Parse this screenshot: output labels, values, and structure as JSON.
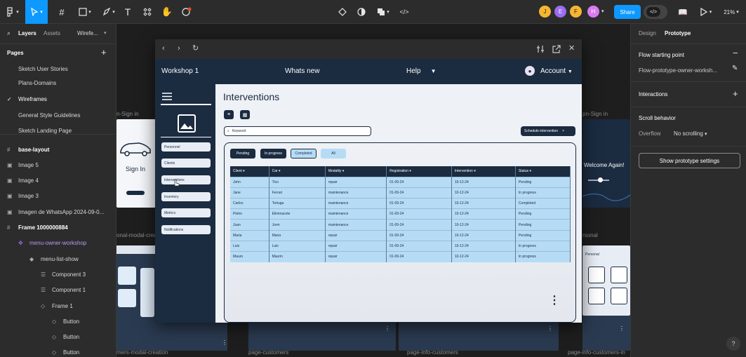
{
  "toolbar": {
    "zoom": "21%",
    "share": "Share",
    "avatars": [
      {
        "letter": "J",
        "color": "#f5b731"
      },
      {
        "letter": "E",
        "color": "#9a6cf0"
      },
      {
        "letter": "F",
        "color": "#f5b731"
      },
      {
        "letter": "H",
        "color": "#d97af0"
      }
    ]
  },
  "left_panel": {
    "tabs": [
      "Layers",
      "Assets"
    ],
    "file": "Wirefe...",
    "pages_title": "Pages",
    "pages": [
      "Sketch User Stories",
      "Plans-Domains",
      "Wireframes",
      "General Style Guidelines",
      "Sketch Landing Page"
    ],
    "current_page": "Wireframes",
    "layers": [
      {
        "name": "base-layout",
        "indent": 0,
        "bold": true
      },
      {
        "name": "Image 5",
        "indent": 0
      },
      {
        "name": "Image 4",
        "indent": 0
      },
      {
        "name": "Image 3",
        "indent": 0
      },
      {
        "name": "Imagen de WhatsApp 2024-09-0...",
        "indent": 0
      },
      {
        "name": "Frame 1000000884",
        "indent": 0,
        "bold": true
      },
      {
        "name": "menu-owner-workshop",
        "indent": 1,
        "purple": true
      },
      {
        "name": "menu-list-show",
        "indent": 2
      },
      {
        "name": "Component 3",
        "indent": 3
      },
      {
        "name": "Component 1",
        "indent": 3
      },
      {
        "name": "Frame 1",
        "indent": 3
      },
      {
        "name": "Button",
        "indent": 4
      },
      {
        "name": "Button",
        "indent": 4
      },
      {
        "name": "Button",
        "indent": 4
      }
    ]
  },
  "right_panel": {
    "tabs": [
      "Design",
      "Prototype"
    ],
    "flow_title": "Flow starting point",
    "flow_name": "Flow-prototype-owner-worksh...",
    "interactions": "Interactions",
    "scroll": "Scroll behavior",
    "overflow_label": "Overflow",
    "overflow_value": "No scrolling",
    "settings_button": "Show prototype settings",
    "help": "?"
  },
  "canvas": {
    "labels": [
      "n-Sign in",
      "onal-modal-crea",
      "pn-Sign in",
      "rsonal",
      "mers-modal-creation",
      "page-customers",
      "page-info-customers",
      "page-info-customers-in"
    ],
    "sign_in": "Sign In",
    "welcome": "Welcome Again!",
    "personal": "Personal"
  },
  "app": {
    "brand": "Workshop 1",
    "whats_new": "Whats new",
    "help": "Help",
    "account": "Account",
    "title": "Interventions",
    "search_placeholder": "Keyword",
    "schedule": "Schedule intervention",
    "side_items": [
      "Personnel",
      "Clients",
      "Interventions",
      "Inventory",
      "Metrics",
      "Notifications"
    ],
    "filters": [
      "Pending",
      "In progress",
      "Completed",
      "All"
    ],
    "columns": [
      "Client",
      "Car",
      "Modality",
      "Registration",
      "Intervention",
      "Status"
    ],
    "rows": [
      [
        "John",
        "Tico",
        "repair",
        "01-09-24",
        "10-12-24",
        "Pending"
      ],
      [
        "Jane",
        "Ferrari",
        "maintenance",
        "01-09-24",
        "10-12-24",
        "In progress"
      ],
      [
        "Carlos",
        "Tortuga",
        "maintenance",
        "01-09-24",
        "10-12-24",
        "Completed"
      ],
      [
        "Pietro",
        "Eliminacote",
        "maintenance",
        "01-09-24",
        "10-12-24",
        "Pending"
      ],
      [
        "Juan",
        "Jorm",
        "maintenance",
        "01-09-24",
        "10-12-24",
        "Pending"
      ],
      [
        "Maria",
        "Maria",
        "repair",
        "01-09-24",
        "10-12-24",
        "Pending"
      ],
      [
        "Luis",
        "Luis",
        "repair",
        "01-09-24",
        "10-12-24",
        "In progress"
      ],
      [
        "Mauro",
        "Maurin",
        "repair",
        "01-09-24",
        "10-12-24",
        "In progress"
      ]
    ]
  }
}
